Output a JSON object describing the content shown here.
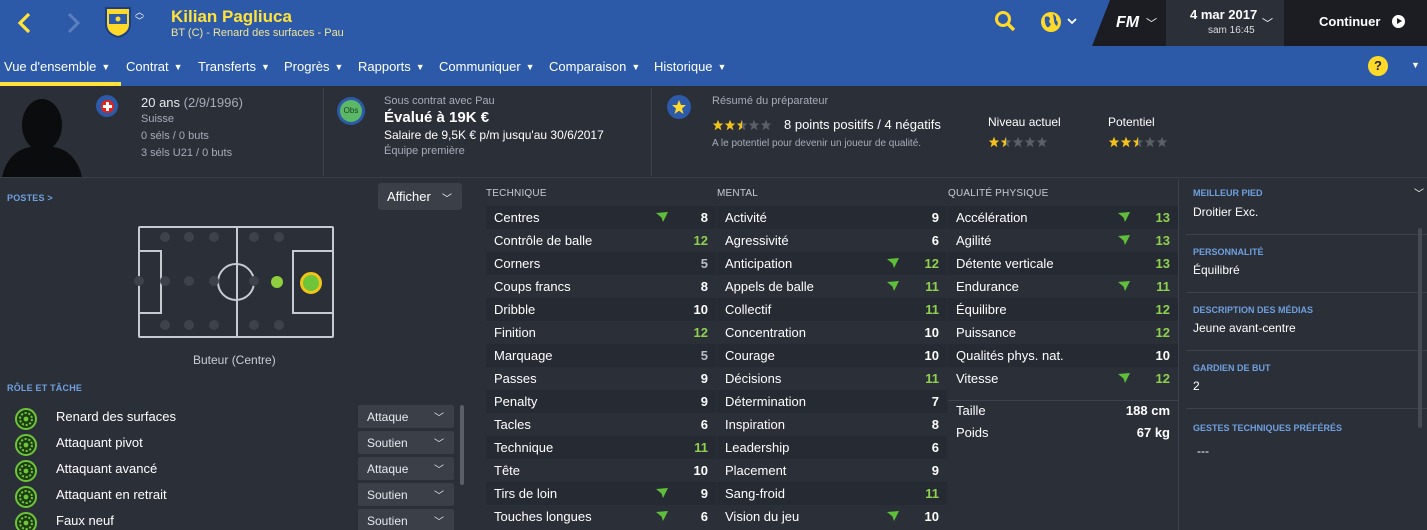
{
  "header": {
    "player_name": "Kilian Pagliuca",
    "player_subtitle": "BT (C) - Renard des surfaces - Pau",
    "fm_logo": "FM",
    "date": "4 mar 2017",
    "time": "sam 16:45",
    "continue_label": "Continuer",
    "icons": [
      "back-arrow-icon",
      "forward-arrow-icon",
      "club-crest-icon",
      "search-icon",
      "globe-icon",
      "play-icon"
    ]
  },
  "nav": {
    "items": [
      "Vue d'ensemble",
      "Contrat",
      "Transferts",
      "Progrès",
      "Rapports",
      "Communiquer",
      "Comparaison",
      "Historique"
    ],
    "active": "Vue d'ensemble",
    "help": "?"
  },
  "info": {
    "age": "20 ans",
    "dob": "(2/9/1996)",
    "nationality": "Suisse",
    "caps": "0 séls / 0 buts",
    "u21_caps": "3 séls U21 / 0 buts",
    "badge_obs": "Obs",
    "contract_with": "Sous contrat avec Pau",
    "value": "Évalué à 19K €",
    "salary": "Salaire de 9,5K € p/m jusqu'au 30/6/2017",
    "squad": "Équipe première",
    "coach_title": "Résumé du préparateur",
    "coach_summary": "8 points positifs / 4 négatifs",
    "coach_note": "A le potentiel pour devenir un joueur de qualité.",
    "coach_stars": 2.5,
    "current_label": "Niveau actuel",
    "current_stars": 1.5,
    "potential_label": "Potentiel",
    "potential_stars": 2.5,
    "star_color": "#f2c21b"
  },
  "positions": {
    "label": "POSTES >",
    "show_button": "Afficher",
    "position_name": "Buteur (Centre)",
    "natural_color": "#6ec53a",
    "accomplished_color": "#8fce3d"
  },
  "roles": {
    "label": "RÔLE ET TÂCHE",
    "items": [
      {
        "name": "Renard des surfaces",
        "duty": "Attaque"
      },
      {
        "name": "Attaquant pivot",
        "duty": "Soutien"
      },
      {
        "name": "Attaquant avancé",
        "duty": "Attaque"
      },
      {
        "name": "Attaquant en retrait",
        "duty": "Soutien"
      },
      {
        "name": "Faux neuf",
        "duty": "Soutien"
      }
    ]
  },
  "technical": {
    "title": "TECHNIQUE",
    "attrs": [
      {
        "name": "Centres",
        "value": "8",
        "arrow": true
      },
      {
        "name": "Contrôle de balle",
        "value": "12",
        "arrow": false
      },
      {
        "name": "Corners",
        "value": "5",
        "arrow": false
      },
      {
        "name": "Coups francs",
        "value": "8",
        "arrow": false
      },
      {
        "name": "Dribble",
        "value": "10",
        "arrow": false
      },
      {
        "name": "Finition",
        "value": "12",
        "arrow": false
      },
      {
        "name": "Marquage",
        "value": "5",
        "arrow": false
      },
      {
        "name": "Passes",
        "value": "9",
        "arrow": false
      },
      {
        "name": "Penalty",
        "value": "9",
        "arrow": false
      },
      {
        "name": "Tacles",
        "value": "6",
        "arrow": false
      },
      {
        "name": "Technique",
        "value": "11",
        "arrow": false
      },
      {
        "name": "Tête",
        "value": "10",
        "arrow": false
      },
      {
        "name": "Tirs de loin",
        "value": "9",
        "arrow": true
      },
      {
        "name": "Touches longues",
        "value": "6",
        "arrow": true
      }
    ]
  },
  "mental": {
    "title": "MENTAL",
    "attrs": [
      {
        "name": "Activité",
        "value": "9",
        "arrow": false
      },
      {
        "name": "Agressivité",
        "value": "6",
        "arrow": false
      },
      {
        "name": "Anticipation",
        "value": "12",
        "arrow": true
      },
      {
        "name": "Appels de balle",
        "value": "11",
        "arrow": true
      },
      {
        "name": "Collectif",
        "value": "11",
        "arrow": false
      },
      {
        "name": "Concentration",
        "value": "10",
        "arrow": false
      },
      {
        "name": "Courage",
        "value": "10",
        "arrow": false
      },
      {
        "name": "Décisions",
        "value": "11",
        "arrow": false
      },
      {
        "name": "Détermination",
        "value": "7",
        "arrow": false
      },
      {
        "name": "Inspiration",
        "value": "8",
        "arrow": false
      },
      {
        "name": "Leadership",
        "value": "6",
        "arrow": false
      },
      {
        "name": "Placement",
        "value": "9",
        "arrow": false
      },
      {
        "name": "Sang-froid",
        "value": "11",
        "arrow": false
      },
      {
        "name": "Vision du jeu",
        "value": "10",
        "arrow": true
      }
    ]
  },
  "physical": {
    "title": "QUALITÉ PHYSIQUE",
    "attrs": [
      {
        "name": "Accélération",
        "value": "13",
        "arrow": true
      },
      {
        "name": "Agilité",
        "value": "13",
        "arrow": true
      },
      {
        "name": "Détente verticale",
        "value": "13",
        "arrow": false
      },
      {
        "name": "Endurance",
        "value": "11",
        "arrow": true
      },
      {
        "name": "Équilibre",
        "value": "12",
        "arrow": false
      },
      {
        "name": "Puissance",
        "value": "12",
        "arrow": false
      },
      {
        "name": "Qualités phys. nat.",
        "value": "10",
        "arrow": false
      },
      {
        "name": "Vitesse",
        "value": "12",
        "arrow": true
      }
    ],
    "height_label": "Taille",
    "height": "188 cm",
    "weight_label": "Poids",
    "weight": "67 kg"
  },
  "details": {
    "items": [
      {
        "label": "MEILLEUR PIED",
        "value": "Droitier Exc."
      },
      {
        "label": "PERSONNALITÉ",
        "value": "Équilibré"
      },
      {
        "label": "DESCRIPTION DES MÉDIAS",
        "value": "Jeune avant-centre"
      },
      {
        "label": "GARDIEN DE BUT",
        "value": "2"
      },
      {
        "label": "GESTES TECHNIQUES PRÉFÉRÉS",
        "value": "---"
      }
    ]
  },
  "colors": {
    "header_blue": "#2c5aa8",
    "accent_yellow": "#ffe23a",
    "green_value": "#8fd14f",
    "white_value": "#ffffff",
    "grey_value": "#b9bec6"
  }
}
